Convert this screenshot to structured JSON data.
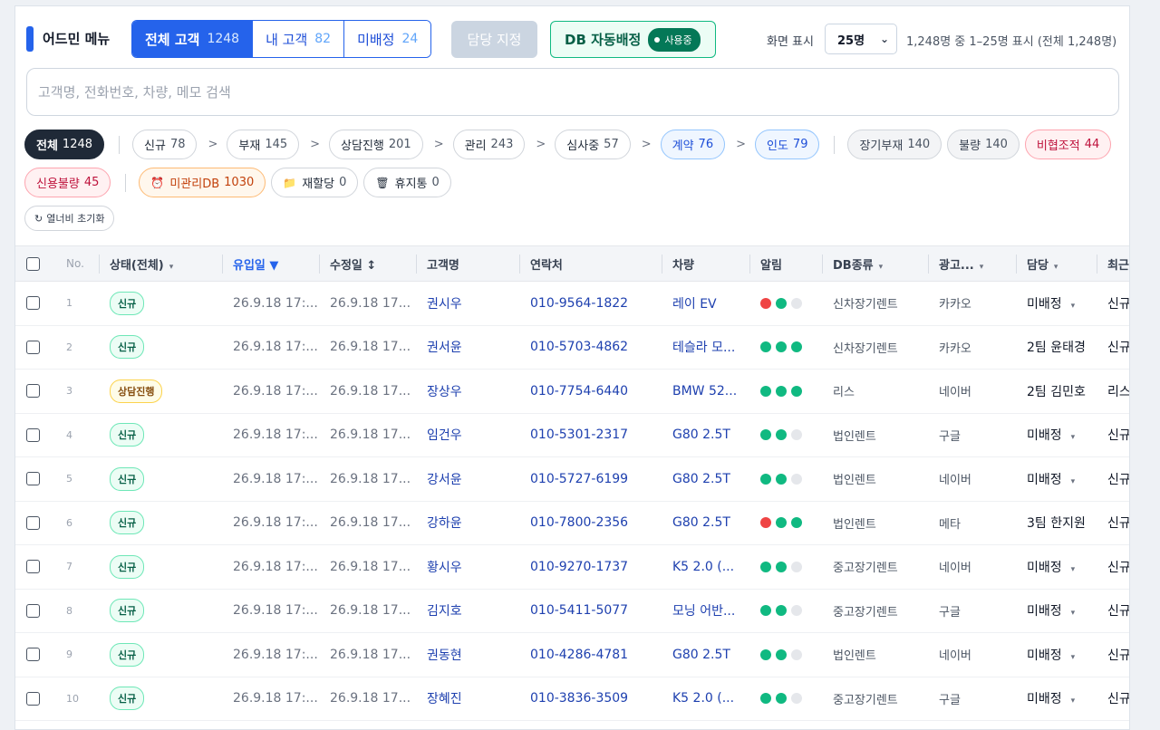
{
  "header": {
    "menu_title": "어드민 메뉴",
    "tabs": [
      {
        "label": "전체 고객",
        "count": "1248",
        "active": true
      },
      {
        "label": "내 고객",
        "count": "82",
        "active": false
      },
      {
        "label": "미배정",
        "count": "24",
        "active": false
      }
    ],
    "assign_label": "담당 지정",
    "auto_label": "DB 자동배정",
    "auto_status": "사용중",
    "display_label": "화면 표시",
    "display_value": "25명",
    "count_text": "1,248명 중 1–25명 표시 (전체 1,248명)"
  },
  "search": {
    "placeholder": "고객명, 전화번호, 차량, 메모 검색"
  },
  "filters": {
    "stages": [
      {
        "label": "전체",
        "count": "1248",
        "style": "dark"
      },
      {
        "label": "신규",
        "count": "78",
        "style": "plain"
      },
      {
        "label": "부재",
        "count": "145",
        "style": "plain"
      },
      {
        "label": "상담진행",
        "count": "201",
        "style": "plain"
      },
      {
        "label": "관리",
        "count": "243",
        "style": "plain"
      },
      {
        "label": "심사중",
        "count": "57",
        "style": "plain"
      },
      {
        "label": "계약",
        "count": "76",
        "style": "blue"
      },
      {
        "label": "인도",
        "count": "79",
        "style": "blue"
      }
    ],
    "extra": [
      {
        "label": "장기부재",
        "count": "140",
        "style": "gray"
      },
      {
        "label": "불량",
        "count": "140",
        "style": "gray"
      },
      {
        "label": "비협조적",
        "count": "44",
        "style": "red"
      }
    ],
    "row2": [
      {
        "label": "신용불량",
        "count": "45",
        "style": "red"
      },
      {
        "label": "미관리DB",
        "count": "1030",
        "style": "orange",
        "icon": "⏰"
      },
      {
        "label": "재할당",
        "count": "0",
        "style": "plain",
        "icon": "📁"
      },
      {
        "label": "휴지통",
        "count": "0",
        "style": "plain",
        "icon": "🗑"
      }
    ],
    "reset_label": "열너비 초기화"
  },
  "table": {
    "columns": [
      {
        "key": "cb",
        "label": ""
      },
      {
        "key": "no",
        "label": "No."
      },
      {
        "key": "status",
        "label": "상태(전체)",
        "caret": "▾"
      },
      {
        "key": "inflow",
        "label": "유입일 ▼",
        "active": true
      },
      {
        "key": "modified",
        "label": "수정일 ↕"
      },
      {
        "key": "name",
        "label": "고객명"
      },
      {
        "key": "phone",
        "label": "연락처"
      },
      {
        "key": "car",
        "label": "차량"
      },
      {
        "key": "alarm",
        "label": "알림"
      },
      {
        "key": "dbtype",
        "label": "DB종류",
        "caret": "▾"
      },
      {
        "key": "ad",
        "label": "광고...",
        "caret": "▾"
      },
      {
        "key": "manager",
        "label": "담당",
        "caret": "▾"
      },
      {
        "key": "recent",
        "label": "최근메"
      }
    ],
    "rows": [
      {
        "no": "1",
        "status": "신규",
        "inflow": "26.9.18 17:...",
        "modified": "26.9.18 17...",
        "name": "권시우",
        "phone": "010-9564-1822",
        "car": "레이 EV",
        "alarm": [
          "r",
          "g",
          "n"
        ],
        "dbtype": "신차장기렌트",
        "ad": "카카오",
        "manager": "미배정",
        "recent": "신규"
      },
      {
        "no": "2",
        "status": "신규",
        "inflow": "26.9.18 17:...",
        "modified": "26.9.18 17...",
        "name": "권서윤",
        "phone": "010-5703-4862",
        "car": "테슬라 모...",
        "alarm": [
          "g",
          "g",
          "g"
        ],
        "dbtype": "신차장기렌트",
        "ad": "카카오",
        "manager": "2팀 윤태경",
        "recent": "신규"
      },
      {
        "no": "3",
        "status": "상담진행",
        "inflow": "26.9.18 17:...",
        "modified": "26.9.18 17...",
        "name": "장상우",
        "phone": "010-7754-6440",
        "car": "BMW 52...",
        "alarm": [
          "g",
          "g",
          "g"
        ],
        "dbtype": "리스",
        "ad": "네이버",
        "manager": "2팀 김민호",
        "recent": "리스"
      },
      {
        "no": "4",
        "status": "신규",
        "inflow": "26.9.18 17:...",
        "modified": "26.9.18 17...",
        "name": "임건우",
        "phone": "010-5301-2317",
        "car": "G80 2.5T",
        "alarm": [
          "g",
          "g",
          "n"
        ],
        "dbtype": "법인렌트",
        "ad": "구글",
        "manager": "미배정",
        "recent": "신규"
      },
      {
        "no": "5",
        "status": "신규",
        "inflow": "26.9.18 17:...",
        "modified": "26.9.18 17...",
        "name": "강서윤",
        "phone": "010-5727-6199",
        "car": "G80 2.5T",
        "alarm": [
          "g",
          "g",
          "n"
        ],
        "dbtype": "법인렌트",
        "ad": "네이버",
        "manager": "미배정",
        "recent": "신규"
      },
      {
        "no": "6",
        "status": "신규",
        "inflow": "26.9.18 17:...",
        "modified": "26.9.18 17...",
        "name": "강하윤",
        "phone": "010-7800-2356",
        "car": "G80 2.5T",
        "alarm": [
          "r",
          "g",
          "g"
        ],
        "dbtype": "법인렌트",
        "ad": "메타",
        "manager": "3팀 한지원",
        "recent": "신규"
      },
      {
        "no": "7",
        "status": "신규",
        "inflow": "26.9.18 17:...",
        "modified": "26.9.18 17...",
        "name": "황시우",
        "phone": "010-9270-1737",
        "car": "K5 2.0 (...",
        "alarm": [
          "g",
          "g",
          "n"
        ],
        "dbtype": "중고장기렌트",
        "ad": "네이버",
        "manager": "미배정",
        "recent": "신규"
      },
      {
        "no": "8",
        "status": "신규",
        "inflow": "26.9.18 17:...",
        "modified": "26.9.18 17...",
        "name": "김지호",
        "phone": "010-5411-5077",
        "car": "모닝 어반...",
        "alarm": [
          "g",
          "g",
          "n"
        ],
        "dbtype": "중고장기렌트",
        "ad": "구글",
        "manager": "미배정",
        "recent": "신규"
      },
      {
        "no": "9",
        "status": "신규",
        "inflow": "26.9.18 17:...",
        "modified": "26.9.18 17...",
        "name": "권동현",
        "phone": "010-4286-4781",
        "car": "G80 2.5T",
        "alarm": [
          "g",
          "g",
          "n"
        ],
        "dbtype": "법인렌트",
        "ad": "네이버",
        "manager": "미배정",
        "recent": "신규"
      },
      {
        "no": "10",
        "status": "신규",
        "inflow": "26.9.18 17:...",
        "modified": "26.9.18 17...",
        "name": "장혜진",
        "phone": "010-3836-3509",
        "car": "K5 2.0 (...",
        "alarm": [
          "g",
          "g",
          "n"
        ],
        "dbtype": "중고장기렌트",
        "ad": "구글",
        "manager": "미배정",
        "recent": "신규"
      }
    ]
  },
  "colors": {
    "accent": "#2563eb",
    "success": "#10b981",
    "danger": "#ef4444"
  }
}
